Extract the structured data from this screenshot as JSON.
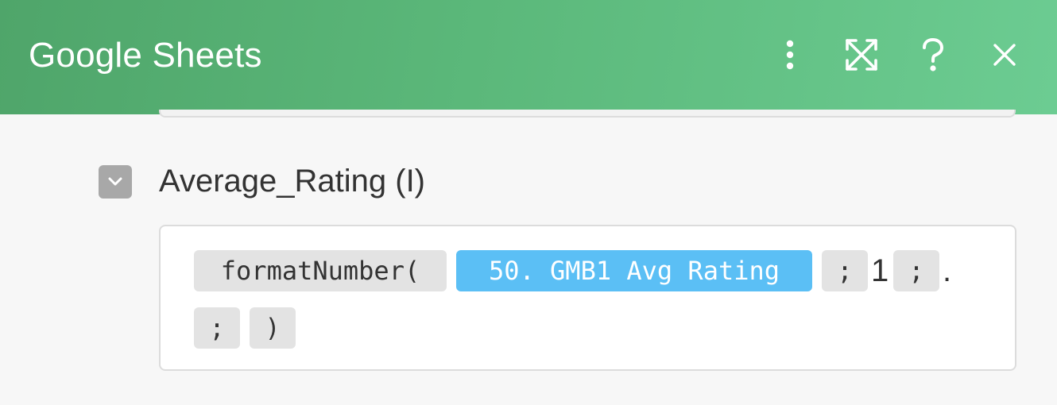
{
  "header": {
    "title": "Google Sheets",
    "actions": [
      {
        "name": "more-options",
        "icon": "vertical-dots-icon"
      },
      {
        "name": "maximize",
        "icon": "expand-arrows-icon"
      },
      {
        "name": "help",
        "icon": "question-mark-icon"
      },
      {
        "name": "close",
        "icon": "close-x-icon"
      }
    ],
    "color_start": "#4fa56a",
    "color_end": "#6ccc92"
  },
  "field": {
    "label": "Average_Rating (I)",
    "toggle_icon": "chevron-down-icon",
    "formula": {
      "function": "formatNumber(",
      "variable": "50. GMB1 Avg Rating",
      "sep1": ";",
      "arg1": "1",
      "sep2": ";",
      "arg2": ".",
      "sep3": ";",
      "close": ")"
    }
  },
  "colors": {
    "variable_pill": "#5bbff5",
    "function_pill": "#e3e3e3",
    "background": "#f7f7f7"
  }
}
